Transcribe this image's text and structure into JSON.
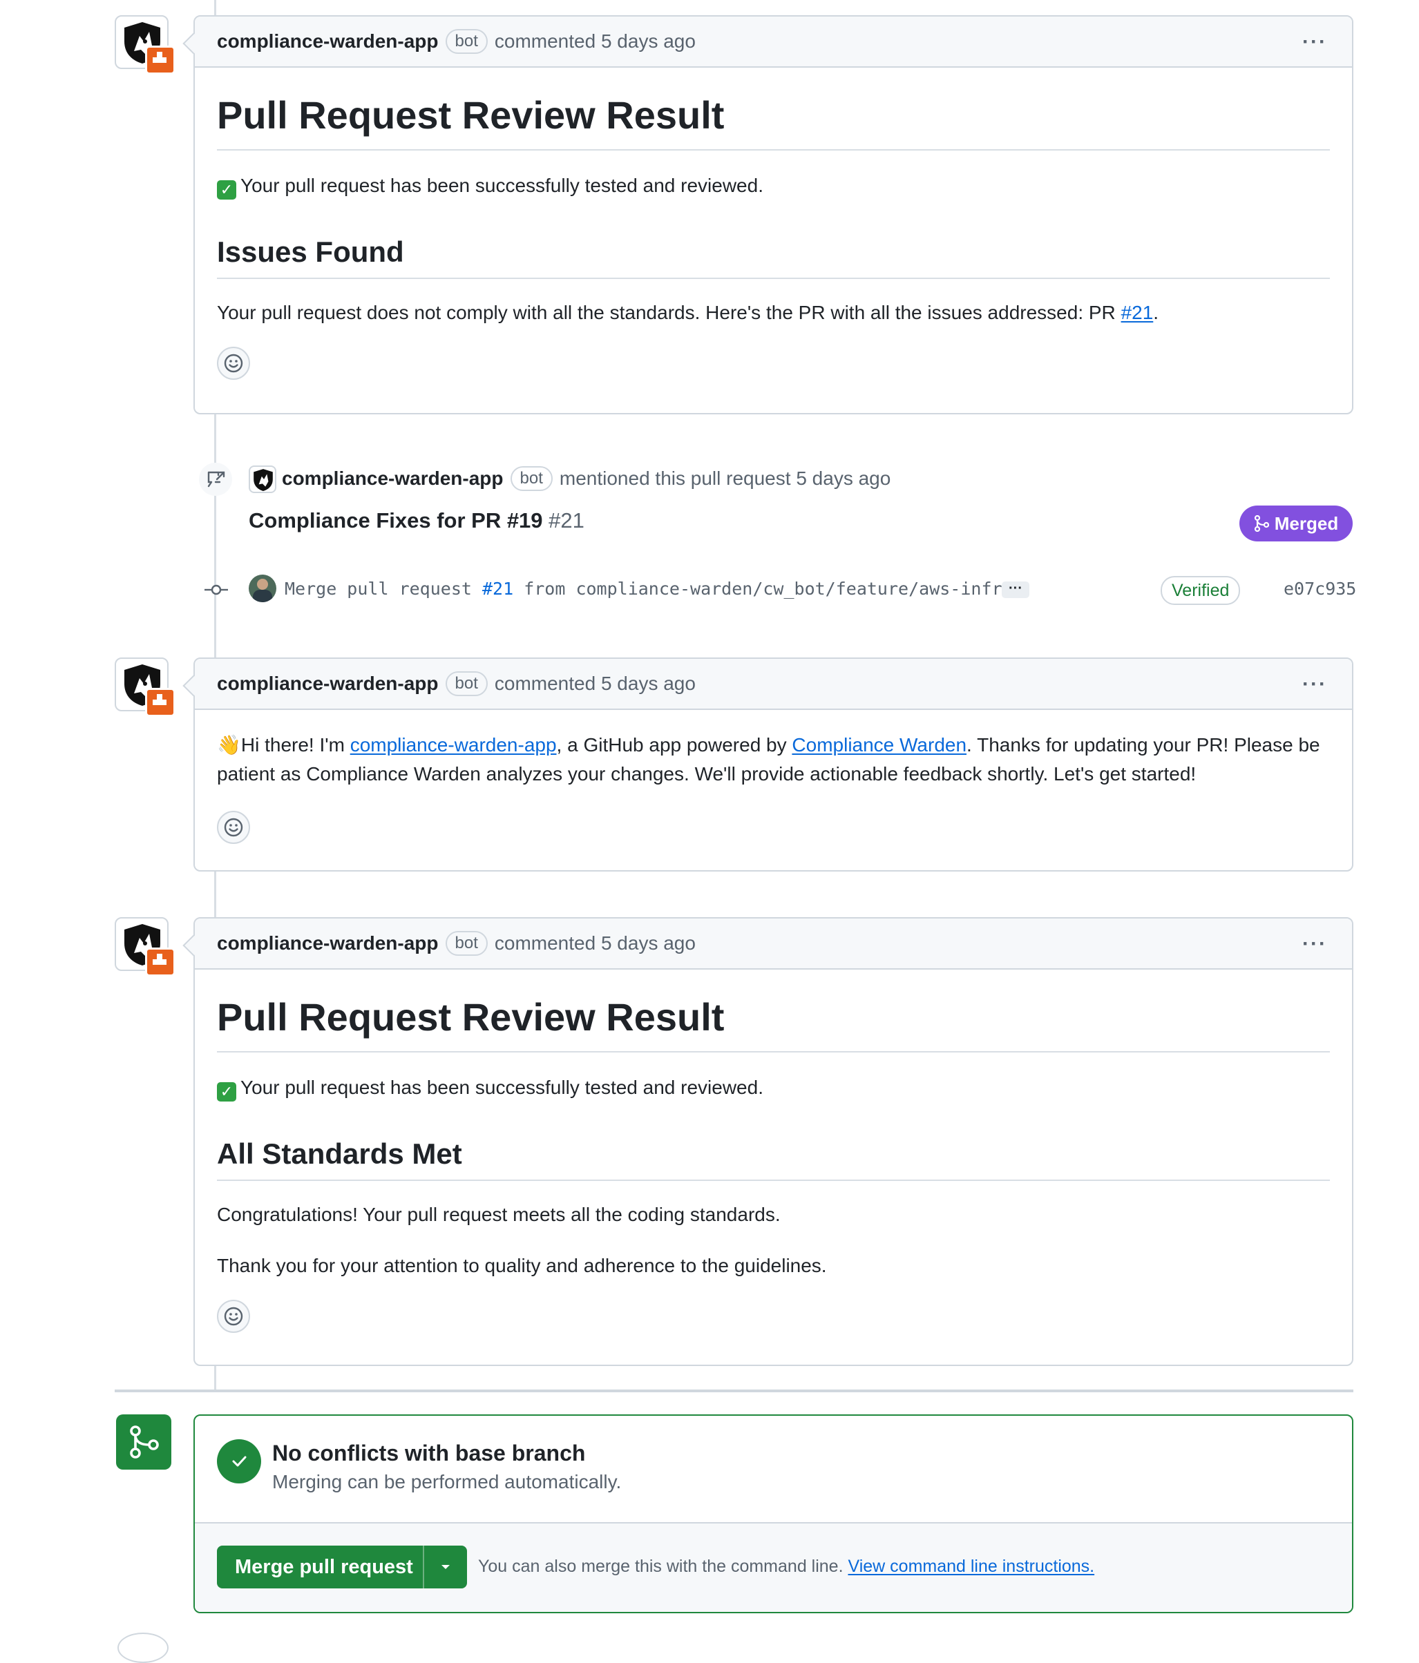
{
  "comments": [
    {
      "author": "compliance-warden-app",
      "badge": "bot",
      "action": "commented 5 days ago",
      "title": "Pull Request Review Result",
      "status_text": "Your pull request has been successfully tested and reviewed.",
      "section_title": "Issues Found",
      "section_text_before": "Your pull request does not comply with all the standards. Here's the PR with all the issues addressed: PR ",
      "section_link": "#21",
      "section_text_after": "."
    },
    {
      "author": "compliance-warden-app",
      "badge": "bot",
      "action": "commented 5 days ago",
      "text_1": "Hi there! I'm ",
      "link_1": "compliance-warden-app",
      "text_2": ", a GitHub app powered by ",
      "link_2": "Compliance Warden",
      "text_3": ". Thanks for updating your PR! Please be patient as Compliance Warden analyzes your changes. We'll provide actionable feedback shortly. Let's get started!",
      "emoji": "👋"
    },
    {
      "author": "compliance-warden-app",
      "badge": "bot",
      "action": "commented 5 days ago",
      "title": "Pull Request Review Result",
      "status_text": "Your pull request has been successfully tested and reviewed.",
      "section_title": "All Standards Met",
      "para_1": "Congratulations! Your pull request meets all the coding standards.",
      "para_2": "Thank you for your attention to quality and adherence to the guidelines."
    }
  ],
  "mention_event": {
    "author": "compliance-warden-app",
    "badge": "bot",
    "action": "mentioned this pull request 5 days ago",
    "pr_title": "Compliance Fixes for PR #19",
    "pr_number": "#21",
    "state": "Merged"
  },
  "commit_event": {
    "message_prefix": "Merge pull request ",
    "message_link": "#21",
    "message_suffix": " from compliance-warden/cw_bot/feature/aws-infr…",
    "more": "···",
    "verified": "Verified",
    "sha": "e07c935"
  },
  "merge_box": {
    "title": "No conflicts with base branch",
    "subtitle": "Merging can be performed automatically.",
    "button_label": "Merge pull request",
    "hint_text": "You can also merge this with the command line. ",
    "hint_link": "View command line instructions."
  },
  "colors": {
    "accent_green": "#1f883d",
    "merged_purple": "#8250df",
    "link_blue": "#0969da",
    "badge_orange": "#e8601c"
  },
  "icons": [
    "shield-logo-icon",
    "smiley-icon",
    "cross-reference-icon",
    "git-merge-icon",
    "git-commit-icon",
    "check-icon",
    "caret-down-icon",
    "kebab-icon"
  ]
}
